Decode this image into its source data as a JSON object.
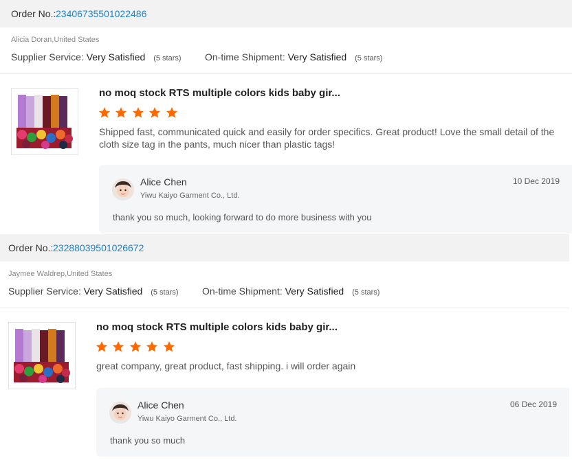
{
  "reviews": [
    {
      "order_label": "Order No.:",
      "order_number": "23406735501022486",
      "buyer": "Alicia Doran,United States",
      "supplier_service_label": "Supplier Service:",
      "supplier_service_value": "Very Satisfied",
      "supplier_service_stars": "(5 stars)",
      "shipment_label": "On-time Shipment:",
      "shipment_value": "Very Satisfied",
      "shipment_stars": "(5 stars)",
      "product_title": "no moq stock RTS multiple colors kids baby gir...",
      "rating": 5,
      "review_text": "Shipped fast, communicated quick and easily for order specifics. Great product! Love the small detail of the cloth size tag in the pants, much nicer than plastic tags!",
      "reply": {
        "name": "Alice Chen",
        "company": "Yiwu Kaiyo Garment Co., Ltd.",
        "date": "10 Dec 2019",
        "message": "thank you so much, looking forward to do more business with you"
      }
    },
    {
      "order_label": "Order No.:",
      "order_number": "23288039501026672",
      "buyer": "Jaymee Waldrep,United States",
      "supplier_service_label": "Supplier Service:",
      "supplier_service_value": "Very Satisfied",
      "supplier_service_stars": "(5 stars)",
      "shipment_label": "On-time Shipment:",
      "shipment_value": "Very Satisfied",
      "shipment_stars": "(5 stars)",
      "product_title": "no moq stock RTS multiple colors kids baby gir...",
      "rating": 5,
      "review_text": "great company, great product, fast shipping. i will order again",
      "reply": {
        "name": "Alice Chen",
        "company": "Yiwu Kaiyo Garment Co., Ltd.",
        "date": "06 Dec 2019",
        "message": "thank you so much"
      }
    }
  ],
  "colors": {
    "order_number": "#1c83c8",
    "star": "#ff6a00",
    "order_bar_bg": "#f2f2f3",
    "reply_bg": "#f5f6f7"
  },
  "icons": {
    "star": "star-icon",
    "product": "product-thumbnail",
    "avatar": "avatar"
  }
}
